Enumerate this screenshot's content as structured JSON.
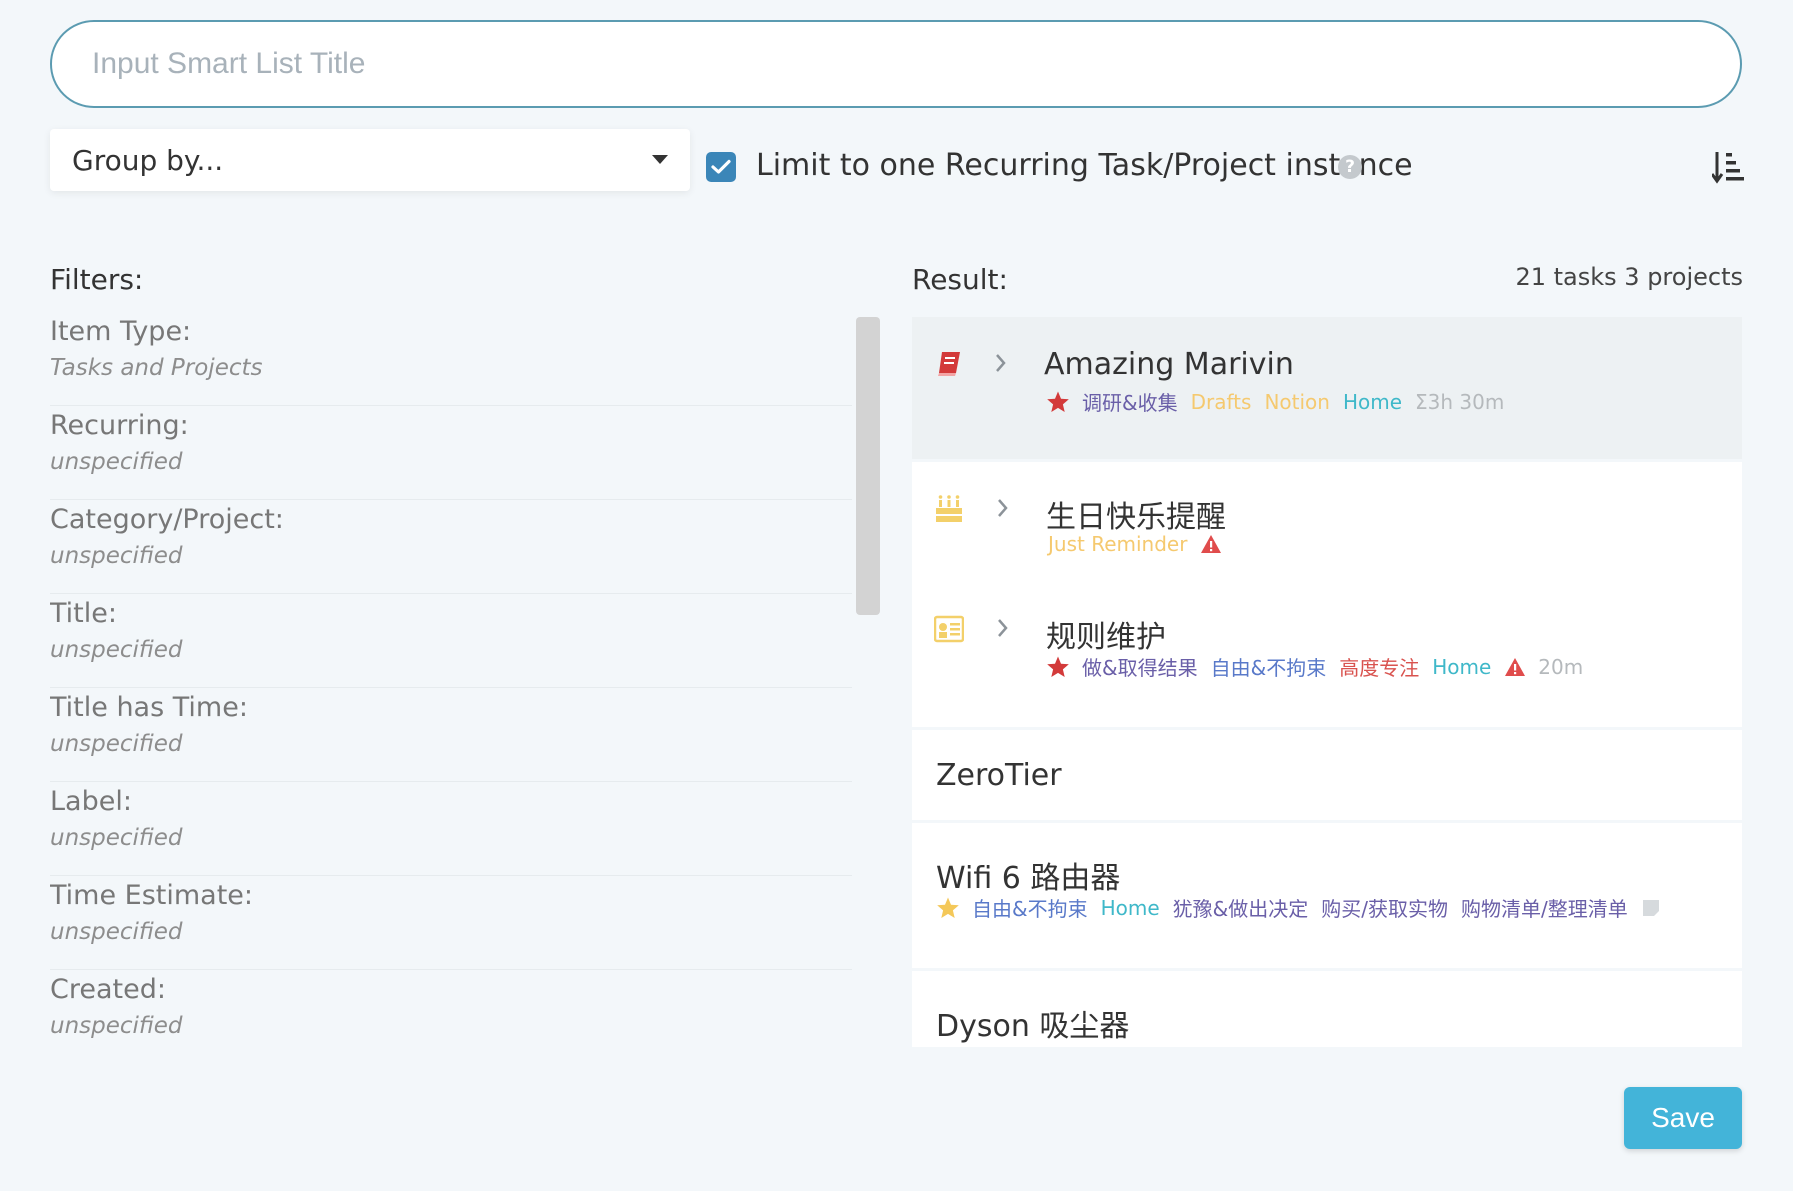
{
  "title_input": {
    "placeholder": "Input Smart List Title",
    "value": ""
  },
  "group_by": {
    "label": "Group by..."
  },
  "limit_option": {
    "label": "Limit to one Recurring Task/Project instance",
    "checked": true
  },
  "icons": {
    "help": "?",
    "help_name": "question-circle-icon",
    "sort": "sort-descending-icon"
  },
  "filters": {
    "heading": "Filters:",
    "items": [
      {
        "label": "Item Type:",
        "value": "Tasks and Projects"
      },
      {
        "label": "Recurring:",
        "value": "unspecified"
      },
      {
        "label": "Category/Project:",
        "value": "unspecified"
      },
      {
        "label": "Title:",
        "value": "unspecified"
      },
      {
        "label": "Title has Time:",
        "value": "unspecified"
      },
      {
        "label": "Label:",
        "value": "unspecified"
      },
      {
        "label": "Time Estimate:",
        "value": "unspecified"
      },
      {
        "label": "Created:",
        "value": "unspecified"
      }
    ]
  },
  "result": {
    "heading": "Result:",
    "count": "21 tasks 3 projects",
    "block1": {
      "title": "Amazing Marivin",
      "icon": "book-icon",
      "tags": [
        "调研&收集",
        "Drafts",
        "Notion",
        "Home"
      ],
      "estimate": "Σ3h 30m"
    },
    "block2": {
      "task1": {
        "title": "生日快乐提醒",
        "icon": "birthday-cake-icon",
        "tags": [
          "Just Reminder"
        ]
      },
      "task2": {
        "title": "规则维护",
        "icon": "id-card-icon",
        "tags": [
          "做&取得结果",
          "自由&不拘束",
          "高度专注",
          "Home"
        ],
        "estimate": "20m"
      }
    },
    "block3": {
      "title": "ZeroTier"
    },
    "block4": {
      "title": "Wifi 6 路由器",
      "tags": [
        "自由&不拘束",
        "Home",
        "犹豫&做出决定",
        "购买/获取实物",
        "购物清单/整理清单"
      ]
    },
    "block5": {
      "title": "Dyson 吸尘器"
    }
  },
  "colors": {
    "accent": "#3b86b8",
    "star_red": "#d33a3a",
    "star_gold": "#f4c859",
    "tag_purple": "#6a5fa8",
    "tag_yellow": "#f5c96f",
    "tag_teal": "#3fb8c9",
    "tag_blue": "#5979c9",
    "tag_red": "#d9534f",
    "muted": "#b5b9bc",
    "save_button": "#43b4d9"
  },
  "save_label": "Save"
}
